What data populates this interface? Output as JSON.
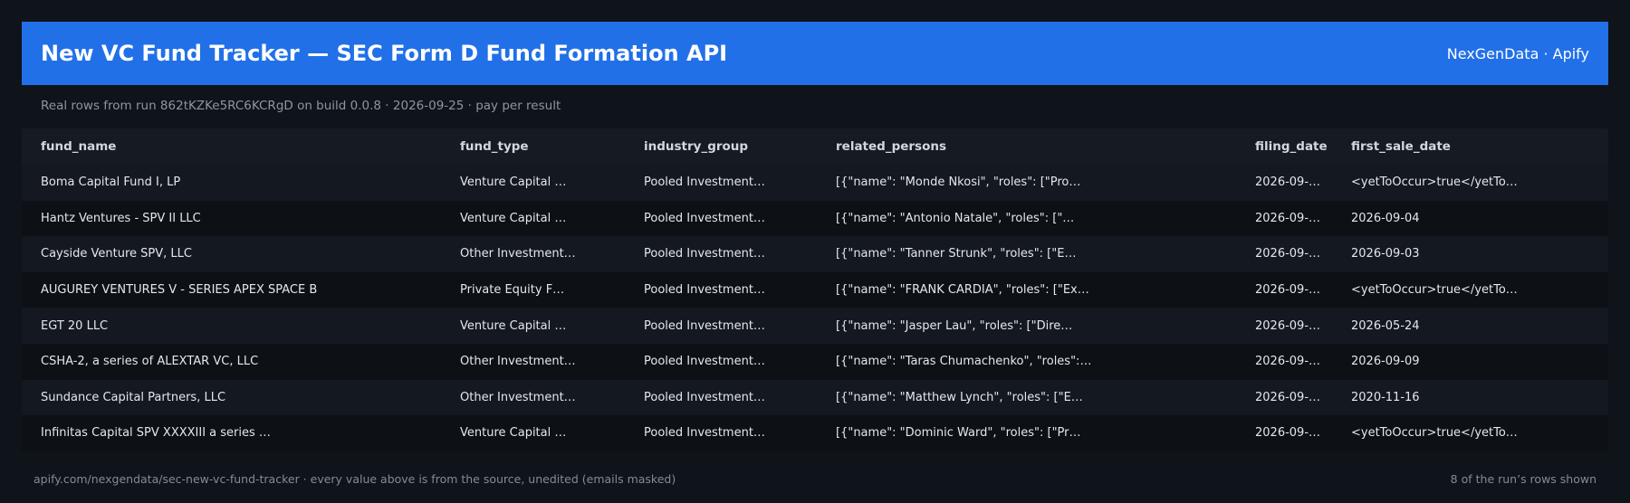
{
  "header": {
    "title": "New VC Fund Tracker — SEC Form D Fund Formation API",
    "brand": "NexGenData · Apify"
  },
  "subtitle": "Real rows from run 862tKZKe5RC6KCRgD on build 0.0.8 · 2026-09-25 · pay per result",
  "table": {
    "columns": [
      "fund_name",
      "fund_type",
      "industry_group",
      "related_persons",
      "filing_date",
      "first_sale_date"
    ],
    "rows": [
      [
        "Boma Capital Fund I, LP",
        "Venture Capital …",
        "Pooled Investment…",
        "[{\"name\": \"Monde Nkosi\", \"roles\": [\"Pro…",
        "2026-09-…",
        "<yetToOccur>true</yetTo…"
      ],
      [
        "Hantz Ventures - SPV II LLC",
        "Venture Capital …",
        "Pooled Investment…",
        "[{\"name\": \"Antonio Natale\", \"roles\": [\"…",
        "2026-09-…",
        "2026-09-04"
      ],
      [
        "Cayside Venture SPV, LLC",
        "Other Investment…",
        "Pooled Investment…",
        "[{\"name\": \"Tanner Strunk\", \"roles\": [\"E…",
        "2026-09-…",
        "2026-09-03"
      ],
      [
        "AUGUREY VENTURES V - SERIES APEX SPACE B",
        "Private Equity F…",
        "Pooled Investment…",
        "[{\"name\": \"FRANK CARDIA\", \"roles\": [\"Ex…",
        "2026-09-…",
        "<yetToOccur>true</yetTo…"
      ],
      [
        "EGT 20 LLC",
        "Venture Capital …",
        "Pooled Investment…",
        "[{\"name\": \"Jasper Lau\", \"roles\": [\"Dire…",
        "2026-09-…",
        "2026-05-24"
      ],
      [
        "CSHA-2, a series of ALEXTAR VC, LLC",
        "Other Investment…",
        "Pooled Investment…",
        "[{\"name\": \"Taras Chumachenko\", \"roles\":…",
        "2026-09-…",
        "2026-09-09"
      ],
      [
        "Sundance Capital Partners, LLC",
        "Other Investment…",
        "Pooled Investment…",
        "[{\"name\": \"Matthew Lynch\", \"roles\": [\"E…",
        "2026-09-…",
        "2020-11-16"
      ],
      [
        "Infinitas Capital SPV XXXXIII a series …",
        "Venture Capital …",
        "Pooled Investment…",
        "[{\"name\": \"Dominic Ward\", \"roles\": [\"Pr…",
        "2026-09-…",
        "<yetToOccur>true</yetTo…"
      ]
    ]
  },
  "footer": {
    "left": "apify.com/nexgendata/sec-new-vc-fund-tracker  ·  every value above is from the source, unedited (emails masked)",
    "right": "8 of the run’s rows shown"
  },
  "colors": {
    "header_bg": "#2170e8",
    "page_bg": "#0f131a"
  }
}
